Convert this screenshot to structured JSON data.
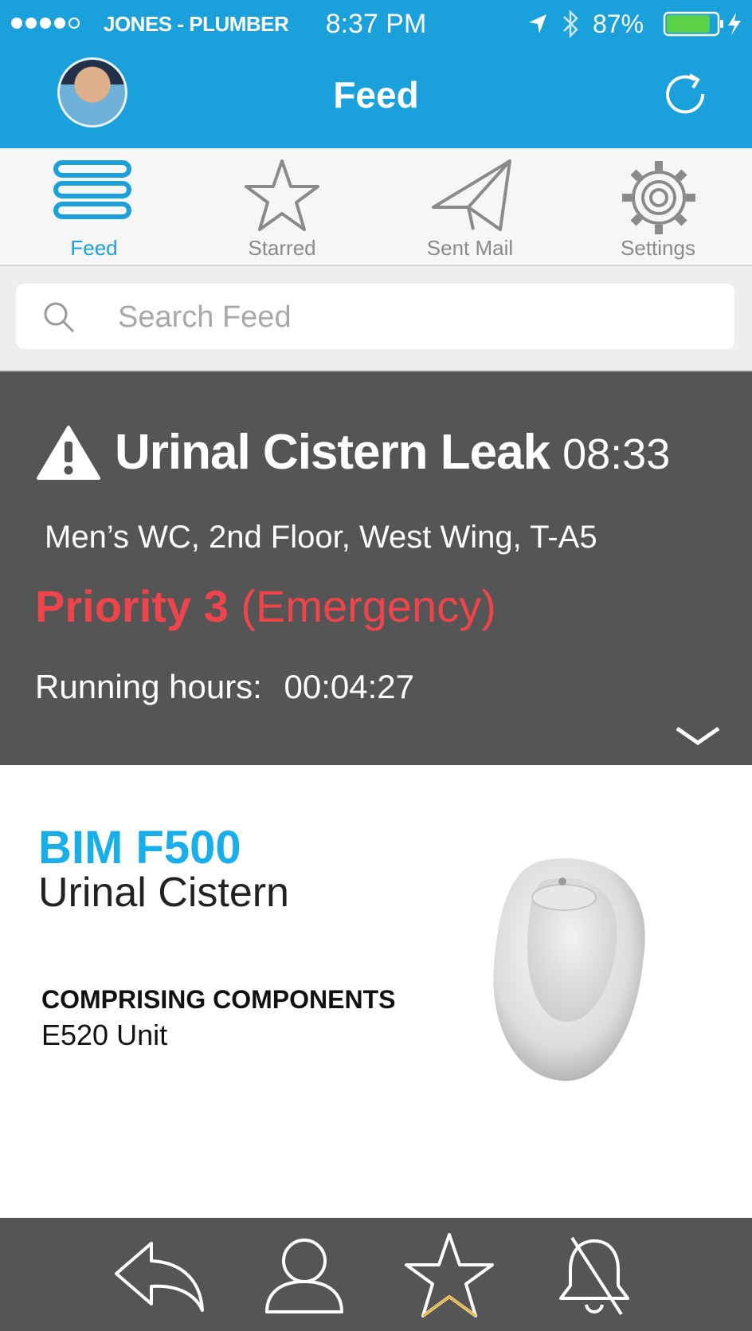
{
  "status_bar": {
    "carrier": "JONES - PLUMBER",
    "time": "8:37 PM",
    "battery": "87%",
    "battery_level": 0.87
  },
  "header": {
    "title": "Feed",
    "avatar_icon": "user-avatar",
    "refresh_icon": "refresh-icon"
  },
  "tabs": [
    {
      "label": "Feed",
      "icon": "list-icon",
      "active": true
    },
    {
      "label": "Starred",
      "icon": "star-icon",
      "active": false
    },
    {
      "label": "Sent Mail",
      "icon": "paper-plane-icon",
      "active": false
    },
    {
      "label": "Settings",
      "icon": "gear-icon",
      "active": false
    }
  ],
  "search": {
    "placeholder": "Search Feed",
    "value": ""
  },
  "alert": {
    "icon": "warning-icon",
    "title": "Urinal Cistern Leak",
    "time": "08:33",
    "location": "Men’s WC, 2nd Floor, West Wing, T-A5",
    "priority": "Priority 3",
    "priority_level": "(Emergency)",
    "running_label": "Running hours:",
    "running_value": "00:04:27"
  },
  "product": {
    "code": "BIM F500",
    "name": "Urinal Cistern",
    "components_heading": "COMPRISING COMPONENTS",
    "components_item": "E520 Unit"
  },
  "bottom_bar": [
    "reply-icon",
    "user-icon",
    "star-icon",
    "bell-off-icon"
  ],
  "colors": {
    "brand_blue": "#1aa0db",
    "alert_bg": "#555555",
    "priority_red": "#f0444c",
    "product_code_blue": "#18aee9"
  }
}
